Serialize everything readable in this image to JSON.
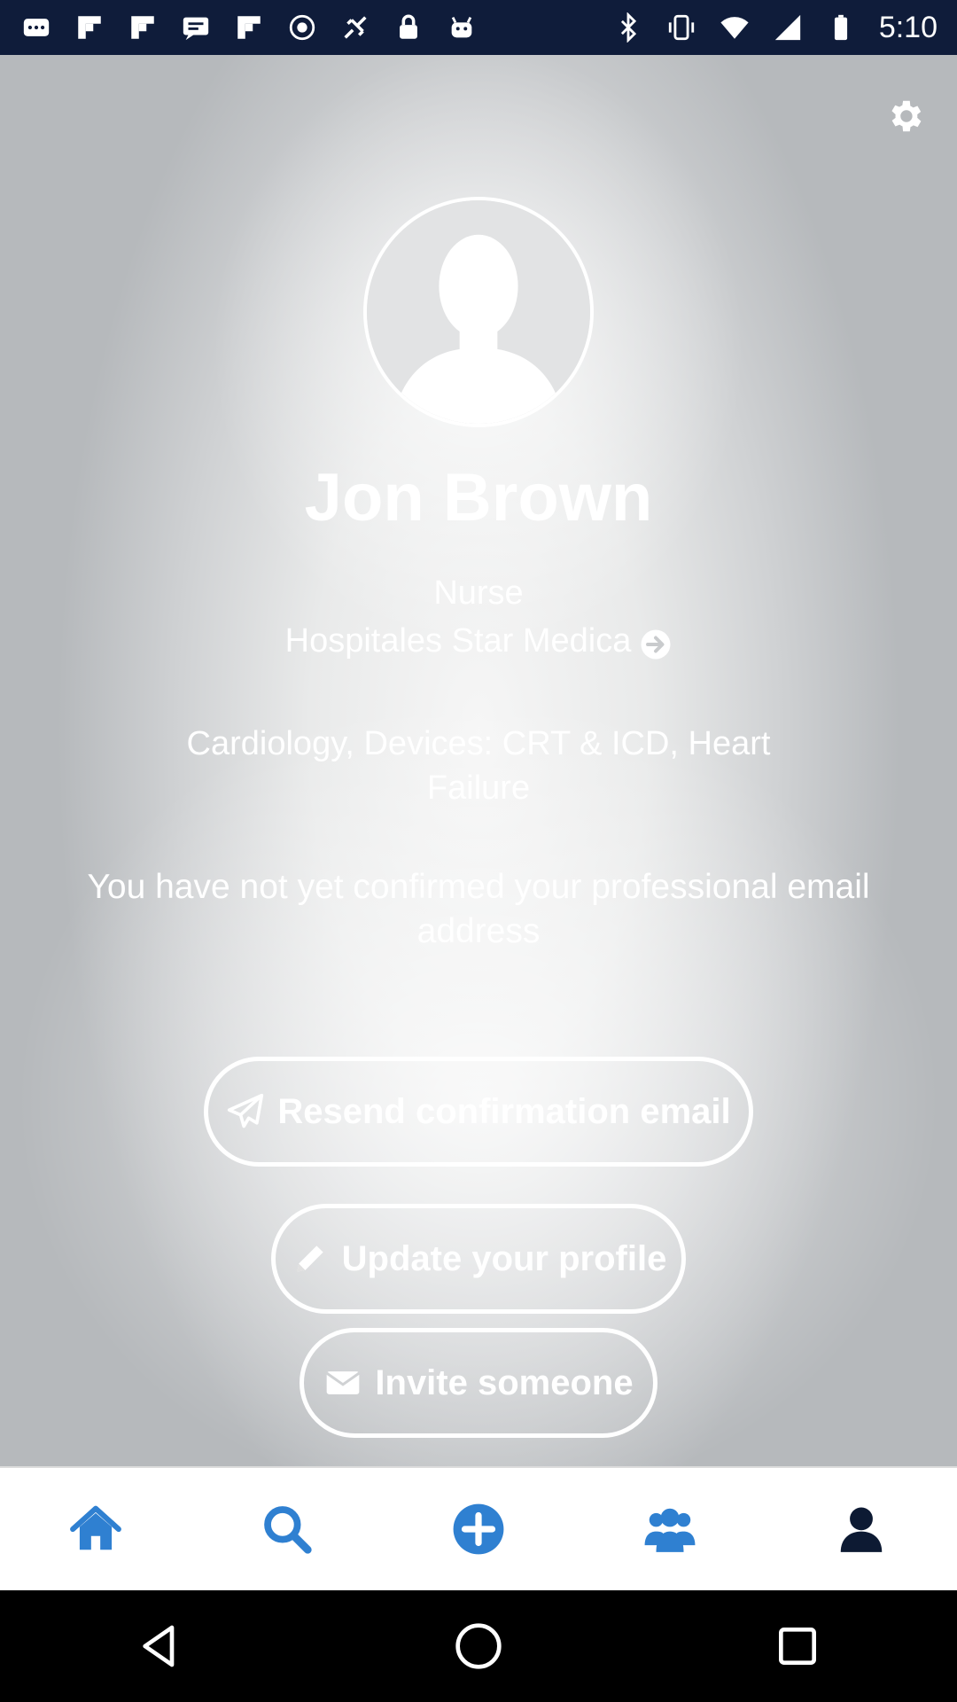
{
  "status_bar": {
    "time": "5:10",
    "left_icons": [
      "messages-icon",
      "flipboard-icon",
      "flipboard-icon",
      "sms-icon",
      "flipboard-icon",
      "cast-icon",
      "fake-gps-icon",
      "lock-icon",
      "android-icon"
    ],
    "right_icons": [
      "bluetooth-icon",
      "vibrate-icon",
      "wifi-icon",
      "cellular-signal-icon",
      "battery-icon"
    ]
  },
  "profile": {
    "name": "Jon Brown",
    "role": "Nurse",
    "hospital": "Hospitales Star Medica",
    "specialties": "Cardiology, Devices: CRT & ICD, Heart Failure",
    "notice": "You have not yet confirmed your professional email address"
  },
  "actions": {
    "resend_label": "Resend confirmation email",
    "update_label": "Update your profile",
    "invite_label": "Invite someone"
  },
  "tabs": [
    {
      "name": "home",
      "icon": "home-icon",
      "color": "#2f80d1"
    },
    {
      "name": "search",
      "icon": "search-icon",
      "color": "#2f80d1"
    },
    {
      "name": "add",
      "icon": "plus-circle-icon",
      "color": "#2f80d1"
    },
    {
      "name": "groups",
      "icon": "users-icon",
      "color": "#2f80d1"
    },
    {
      "name": "profile",
      "icon": "user-icon",
      "color": "#0d1a33"
    }
  ],
  "colors": {
    "accent": "#2f80d1",
    "active_tab": "#0d1a33",
    "status_bar": "#0f1c3a"
  }
}
